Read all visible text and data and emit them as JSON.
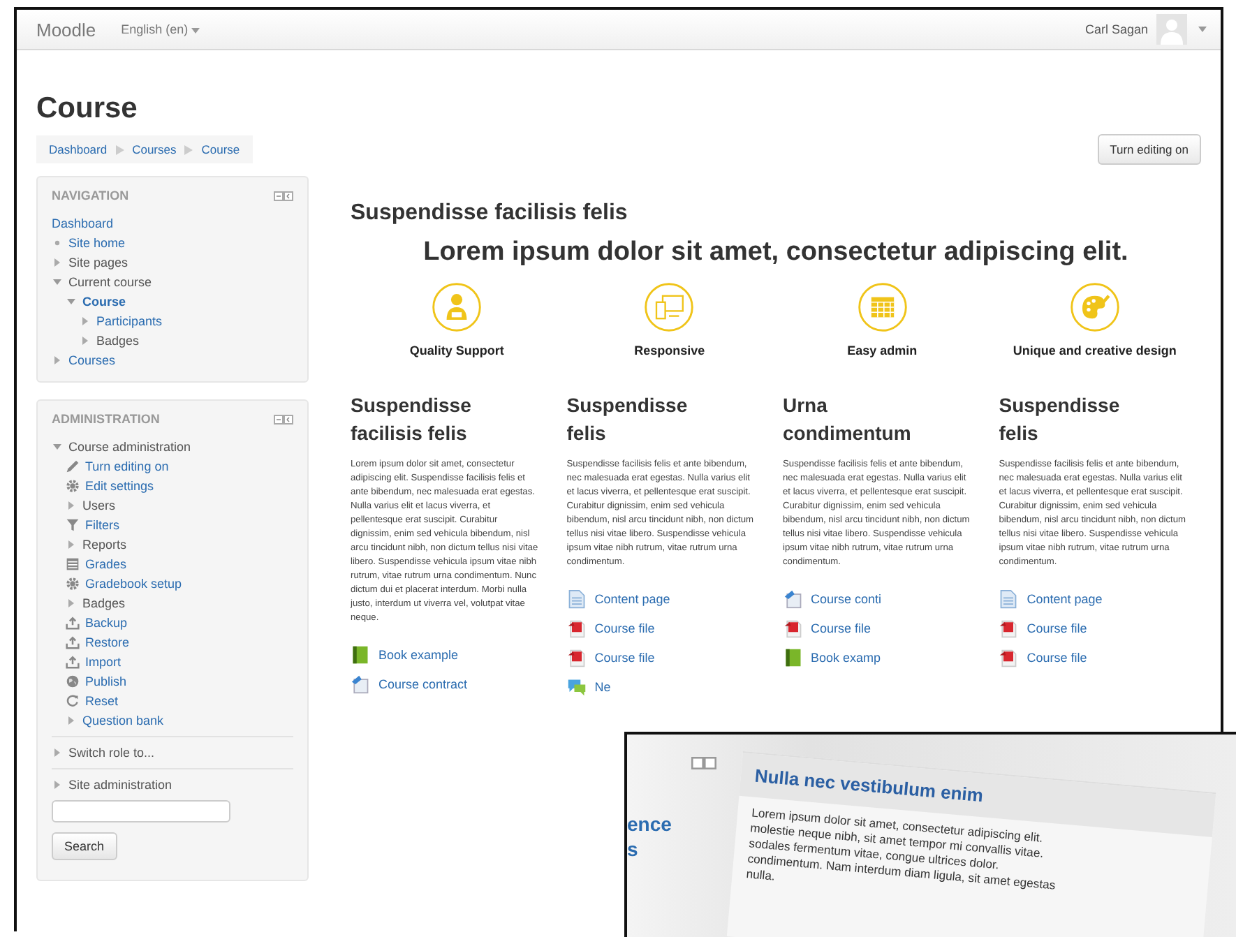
{
  "navbar": {
    "brand": "Moodle",
    "language": "English (en)",
    "user": "Carl Sagan"
  },
  "page": {
    "title": "Course",
    "breadcrumb": [
      "Dashboard",
      "Courses",
      "Course"
    ],
    "edit_button": "Turn editing on"
  },
  "navigation": {
    "title": "NAVIGATION",
    "items": [
      {
        "label": "Dashboard",
        "kind": "plain",
        "link": true,
        "current": false
      },
      {
        "label": "Site home",
        "kind": "leaf",
        "link": true,
        "current": false
      },
      {
        "label": "Site pages",
        "kind": "branch",
        "expanded": false,
        "link": false,
        "current": false
      },
      {
        "label": "Current course",
        "kind": "branch",
        "expanded": true,
        "link": false,
        "current": false,
        "children": [
          {
            "label": "Course",
            "kind": "branch",
            "expanded": true,
            "link": true,
            "current": true,
            "children": [
              {
                "label": "Participants",
                "kind": "branch",
                "expanded": false,
                "link": true,
                "current": false
              },
              {
                "label": "Badges",
                "kind": "branch",
                "expanded": false,
                "link": false,
                "current": false
              }
            ]
          }
        ]
      },
      {
        "label": "Courses",
        "kind": "branch",
        "expanded": false,
        "link": true,
        "current": false
      }
    ]
  },
  "administration": {
    "title": "ADMINISTRATION",
    "items": [
      {
        "label": "Course administration",
        "kind": "branch",
        "expanded": true,
        "link": false,
        "children": [
          {
            "label": "Turn editing on",
            "kind": "pencil",
            "link": true
          },
          {
            "label": "Edit settings",
            "kind": "gear",
            "link": true
          },
          {
            "label": "Users",
            "kind": "branch",
            "expanded": false,
            "link": false
          },
          {
            "label": "Filters",
            "kind": "filter",
            "link": true
          },
          {
            "label": "Reports",
            "kind": "branch",
            "expanded": false,
            "link": false
          },
          {
            "label": "Grades",
            "kind": "table",
            "link": true
          },
          {
            "label": "Gradebook setup",
            "kind": "gear",
            "link": true
          },
          {
            "label": "Badges",
            "kind": "branch",
            "expanded": false,
            "link": false
          },
          {
            "label": "Backup",
            "kind": "upload",
            "link": true
          },
          {
            "label": "Restore",
            "kind": "upload",
            "link": true
          },
          {
            "label": "Import",
            "kind": "upload",
            "link": true
          },
          {
            "label": "Publish",
            "kind": "globe",
            "link": true
          },
          {
            "label": "Reset",
            "kind": "reset",
            "link": true
          },
          {
            "label": "Question bank",
            "kind": "branch",
            "expanded": false,
            "link": true
          }
        ]
      },
      {
        "label": "Switch role to...",
        "kind": "branch",
        "expanded": false,
        "link": false
      },
      {
        "label": "Site administration",
        "kind": "branch",
        "expanded": false,
        "link": false
      }
    ],
    "search_button": "Search"
  },
  "main": {
    "heading": "Suspendisse facilisis felis",
    "tagline": "Lorem ipsum dolor sit amet, consectetur adipiscing elit.",
    "features": [
      {
        "label": "Quality Support",
        "kind": "person"
      },
      {
        "label": "Responsive",
        "kind": "devices"
      },
      {
        "label": "Easy admin",
        "kind": "grid"
      },
      {
        "label": "Unique and creative design",
        "kind": "palette"
      }
    ],
    "columns": [
      {
        "title": "Suspendisse facilisis felis",
        "text": "Lorem ipsum dolor sit amet, consectetur adipiscing elit. Suspendisse facilisis felis et ante bibendum, nec malesuada erat egestas. Nulla varius elit et lacus viverra, et pellentesque erat suscipit. Curabitur dignissim, enim sed vehicula bibendum, nisl arcu tincidunt nibh, non dictum tellus nisi vitae libero. Suspendisse vehicula ipsum vitae nibh rutrum, vitae rutrum urna condimentum. Nunc dictum dui et placerat interdum. Morbi nulla justo, interdum ut viverra vel, volutpat vitae neque.",
        "links": [
          {
            "label": "Book example",
            "kind": "book"
          },
          {
            "label": "Course contract",
            "kind": "contract"
          }
        ]
      },
      {
        "title": "Suspendisse felis",
        "text": "Suspendisse facilisis felis et ante bibendum, nec malesuada erat egestas. Nulla varius elit et lacus viverra, et pellentesque erat suscipit. Curabitur dignissim, enim sed vehicula bibendum, nisl arcu tincidunt nibh, non dictum tellus nisi vitae libero. Suspendisse vehicula ipsum vitae nibh rutrum, vitae rutrum urna condimentum.",
        "links": [
          {
            "label": "Content page",
            "kind": "page"
          },
          {
            "label": "Course file",
            "kind": "file"
          },
          {
            "label": "Course file",
            "kind": "file"
          },
          {
            "label": "Ne",
            "kind": "forum"
          }
        ]
      },
      {
        "title": "Urna condimentum",
        "text": "Suspendisse facilisis felis et ante bibendum, nec malesuada erat egestas. Nulla varius elit et lacus viverra, et pellentesque erat suscipit. Curabitur dignissim, enim sed vehicula bibendum, nisl arcu tincidunt nibh, non dictum tellus nisi vitae libero. Suspendisse vehicula ipsum vitae nibh rutrum, vitae rutrum urna condimentum.",
        "links": [
          {
            "label": "Course conti",
            "kind": "contract"
          },
          {
            "label": "Course file",
            "kind": "file"
          },
          {
            "label": "Book examp",
            "kind": "book"
          }
        ]
      },
      {
        "title": "Suspendisse felis",
        "text": "Suspendisse facilisis felis et ante bibendum, nec malesuada erat egestas. Nulla varius elit et lacus viverra, et pellentesque erat suscipit. Curabitur dignissim, enim sed vehicula bibendum, nisl arcu tincidunt nibh, non dictum tellus nisi vitae libero. Suspendisse vehicula ipsum vitae nibh rutrum, vitae rutrum urna condimentum.",
        "links": [
          {
            "label": "Content page",
            "kind": "page"
          },
          {
            "label": "Course file",
            "kind": "file"
          },
          {
            "label": "Course file",
            "kind": "file"
          }
        ]
      }
    ]
  },
  "inset": {
    "side_links": [
      "ence",
      "s"
    ],
    "card_title": "Nulla nec vestibulum enim",
    "card_lines": [
      "Lorem ipsum dolor sit amet, consectetur adipiscing elit.",
      "molestie neque nibh, sit amet tempor mi convallis vitae.",
      "sodales fermentum vitae, congue ultrices dolor.",
      "condimentum. Nam interdum diam ligula, sit amet egestas",
      "nulla."
    ]
  }
}
